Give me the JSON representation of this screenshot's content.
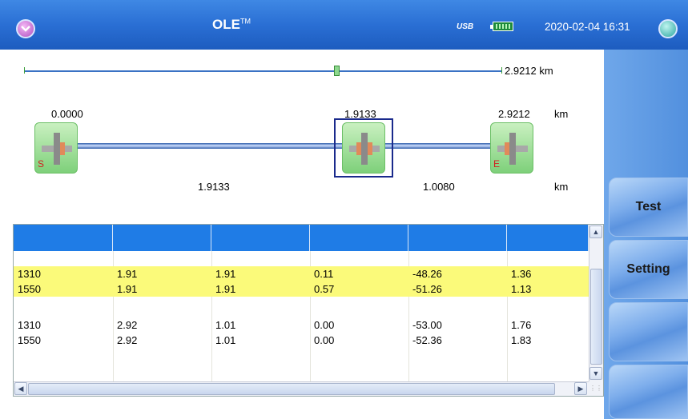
{
  "header": {
    "title": "OLE",
    "title_sup": "TM",
    "usb_label": "USB",
    "datetime": "2020-02-04 16:31"
  },
  "icons": {
    "menu": "chevron-down-icon",
    "usb": "usb-icon",
    "battery": "battery-icon",
    "app": "app-icon"
  },
  "trace": {
    "total_length": "2.9212 km",
    "marker_fraction": 0.655,
    "positions": [
      "0.0000",
      "1.9133",
      "2.9212"
    ],
    "positions_unit": "km",
    "sections": [
      "1.9133",
      "1.0080"
    ],
    "sections_unit": "km",
    "start_tag": "S",
    "end_tag": "E"
  },
  "side_buttons": {
    "test": "Test",
    "setting": "Setting"
  },
  "table": {
    "rows": [
      {
        "highlight": true,
        "cells": [
          "1310",
          "1.91",
          "1.91",
          "0.11",
          "-48.26",
          "1.36"
        ]
      },
      {
        "highlight": true,
        "cells": [
          "1550",
          "1.91",
          "1.91",
          "0.57",
          "-51.26",
          "1.13"
        ]
      },
      {
        "highlight": false,
        "cells": [
          "",
          "",
          "",
          "",
          "",
          ""
        ]
      },
      {
        "highlight": false,
        "cells": [
          "1310",
          "2.92",
          "1.01",
          "0.00",
          "-53.00",
          "1.76"
        ]
      },
      {
        "highlight": false,
        "cells": [
          "1550",
          "2.92",
          "1.01",
          "0.00",
          "-52.36",
          "1.83"
        ]
      }
    ]
  },
  "colors": {
    "title_bar": "#2a6fd4",
    "table_header": "#1f7ce6",
    "highlight_row": "#fbfa7a",
    "node_green": "#7ed07a",
    "selection_border": "#1a2a8c"
  }
}
